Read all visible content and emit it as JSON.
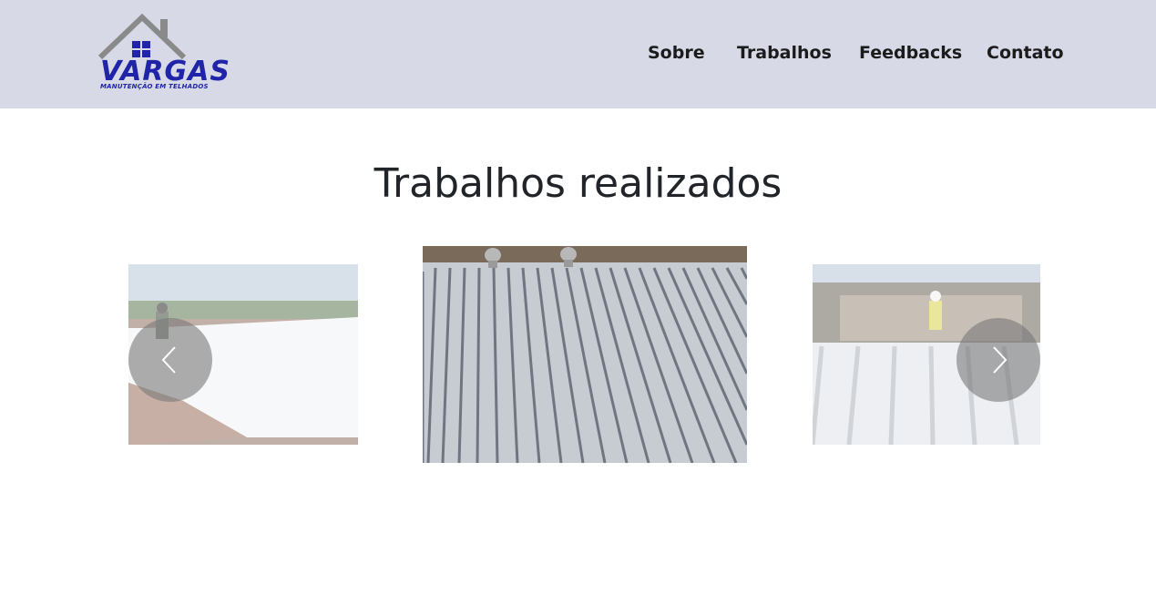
{
  "brand": {
    "name": "VARGAS",
    "tagline": "MANUTENÇÃO EM TELHADOS",
    "primary_color": "#1f24a8",
    "roof_color": "#8a8a8a"
  },
  "header": {
    "background": "#d7d9e7"
  },
  "nav": {
    "items": [
      {
        "label": "Sobre"
      },
      {
        "label": "Trabalhos"
      },
      {
        "label": "Feedbacks"
      },
      {
        "label": "Contato"
      }
    ]
  },
  "works": {
    "title": "Trabalhos realizados",
    "slides": [
      {
        "description": "white-coated-roof-worker-spraying"
      },
      {
        "description": "corrugated-metal-roof-with-ventilators"
      },
      {
        "description": "worker-on-white-metal-roof"
      }
    ],
    "prev_icon": "chevron-left-icon",
    "next_icon": "chevron-right-icon"
  }
}
